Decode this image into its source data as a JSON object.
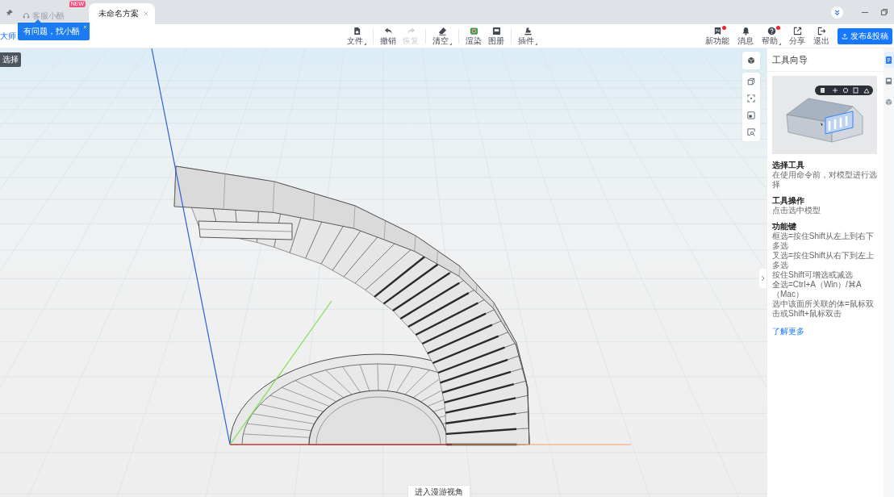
{
  "title_bar": {
    "tabs": [
      {
        "kind": "service",
        "label": "客服小酷",
        "badge": "NEW",
        "selected": false,
        "closable": false
      },
      {
        "kind": "document",
        "label": "未命名方案",
        "selected": true,
        "closable": true
      }
    ]
  },
  "toolbar": {
    "brand_text": "大师",
    "tool_groups": [
      {
        "tools": [
          {
            "kind": "file",
            "label": "文件",
            "dropdown": true,
            "disabled": false
          }
        ]
      },
      {
        "tools": [
          {
            "kind": "undo",
            "label": "撤销",
            "dropdown": false,
            "disabled": false
          },
          {
            "kind": "redo",
            "label": "恢复",
            "dropdown": false,
            "disabled": true
          }
        ]
      },
      {
        "tools": [
          {
            "kind": "clear",
            "label": "清空",
            "dropdown": true,
            "disabled": false
          }
        ]
      },
      {
        "tools": [
          {
            "kind": "render",
            "label": "渲染",
            "dropdown": false,
            "disabled": false
          },
          {
            "kind": "album",
            "label": "图册",
            "dropdown": false,
            "disabled": false
          }
        ]
      },
      {
        "tools": [
          {
            "kind": "plugin",
            "label": "插件",
            "dropdown": true,
            "disabled": false
          }
        ]
      }
    ],
    "actions": [
      {
        "kind": "whats-new",
        "label": "新功能",
        "dot": true,
        "dropdown": false
      },
      {
        "kind": "messages",
        "label": "消息",
        "dot": false,
        "dropdown": false
      },
      {
        "kind": "help",
        "label": "帮助",
        "dot": true,
        "dropdown": true
      },
      {
        "kind": "share",
        "label": "分享",
        "dot": false,
        "dropdown": false
      },
      {
        "kind": "exit",
        "label": "退出",
        "dot": false,
        "dropdown": false
      }
    ],
    "publish_button": "发布&投稿"
  },
  "tooltip": {
    "text": "有问题，找小酷"
  },
  "viewport": {
    "mode_label": "选择",
    "roam_button": "进入漫游视角"
  },
  "panel": {
    "title": "工具向导",
    "sections": [
      {
        "heading": "选择工具",
        "lines": [
          "在使用命令前，对模型进行选择"
        ]
      },
      {
        "heading": "工具操作",
        "lines": [
          "点击选中模型"
        ]
      },
      {
        "heading": "功能键",
        "lines": [
          "框选=按住Shift从左上到右下多选",
          "叉选=按住Shift从右下到左上多选",
          "按住Shift可增选或减选",
          "全选=Ctrl+A（Win）/⌘A（Mac）",
          "选中该面所关联的体=鼠标双击或Shift+鼠标双击"
        ]
      }
    ],
    "link": "了解更多"
  },
  "side_tabs": [
    {
      "kind": "guide",
      "selected": true
    },
    {
      "kind": "image",
      "selected": false
    },
    {
      "kind": "model",
      "selected": false
    }
  ]
}
